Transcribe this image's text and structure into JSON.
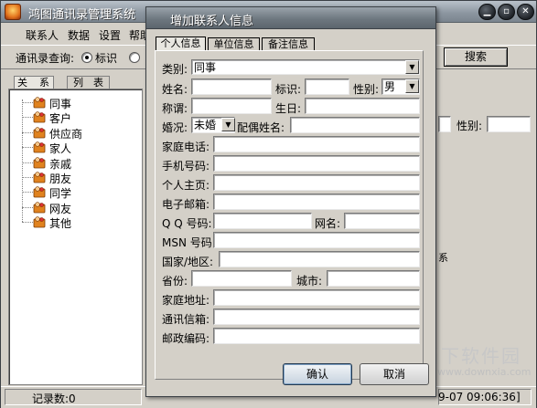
{
  "main_window": {
    "title": "鸿图通讯录管理系统",
    "menu": [
      "联系人",
      "数据",
      "设置",
      "帮助"
    ],
    "query_label": "通讯录查询:",
    "radio_label": "标识",
    "search_button": "搜索",
    "tabs": [
      "关　系",
      "列　表"
    ],
    "tree_items": [
      "同事",
      "客户",
      "供应商",
      "家人",
      "亲戚",
      "朋友",
      "同学",
      "网友",
      "其他"
    ],
    "right_gender_label": "性别:",
    "status_count": "记录数:0",
    "status_datetime": "9-07 09:06:36]"
  },
  "dialog": {
    "title": "增加联系人信息",
    "tabs": [
      "个人信息",
      "单位信息",
      "备注信息"
    ],
    "labels": {
      "category": "类别:",
      "name": "姓名:",
      "identifier": "标识:",
      "gender": "性别:",
      "title": "称谓:",
      "birthday": "生日:",
      "marital": "婚况:",
      "spouse": "配偶姓名:",
      "home_phone": "家庭电话:",
      "mobile": "手机号码:",
      "homepage": "个人主页:",
      "email": "电子邮箱:",
      "qq": "Q Q 号码:",
      "nickname": "网名:",
      "msn": "MSN 号码:",
      "country": "国家/地区:",
      "province": "省份:",
      "city": "城市:",
      "address": "家庭地址:",
      "mail_address": "通讯信箱:",
      "postcode": "邮政编码:"
    },
    "values": {
      "category": "同事",
      "gender": "男",
      "marital": "未婚"
    },
    "ok_button": "确认",
    "cancel_button": "取消"
  },
  "watermark": {
    "brand": "当下软件园",
    "url": "www.downxia.com"
  },
  "colors": {
    "face": "#d4d0c8",
    "titlebar": "#7a848e",
    "folder_orange": "#e0821e"
  }
}
